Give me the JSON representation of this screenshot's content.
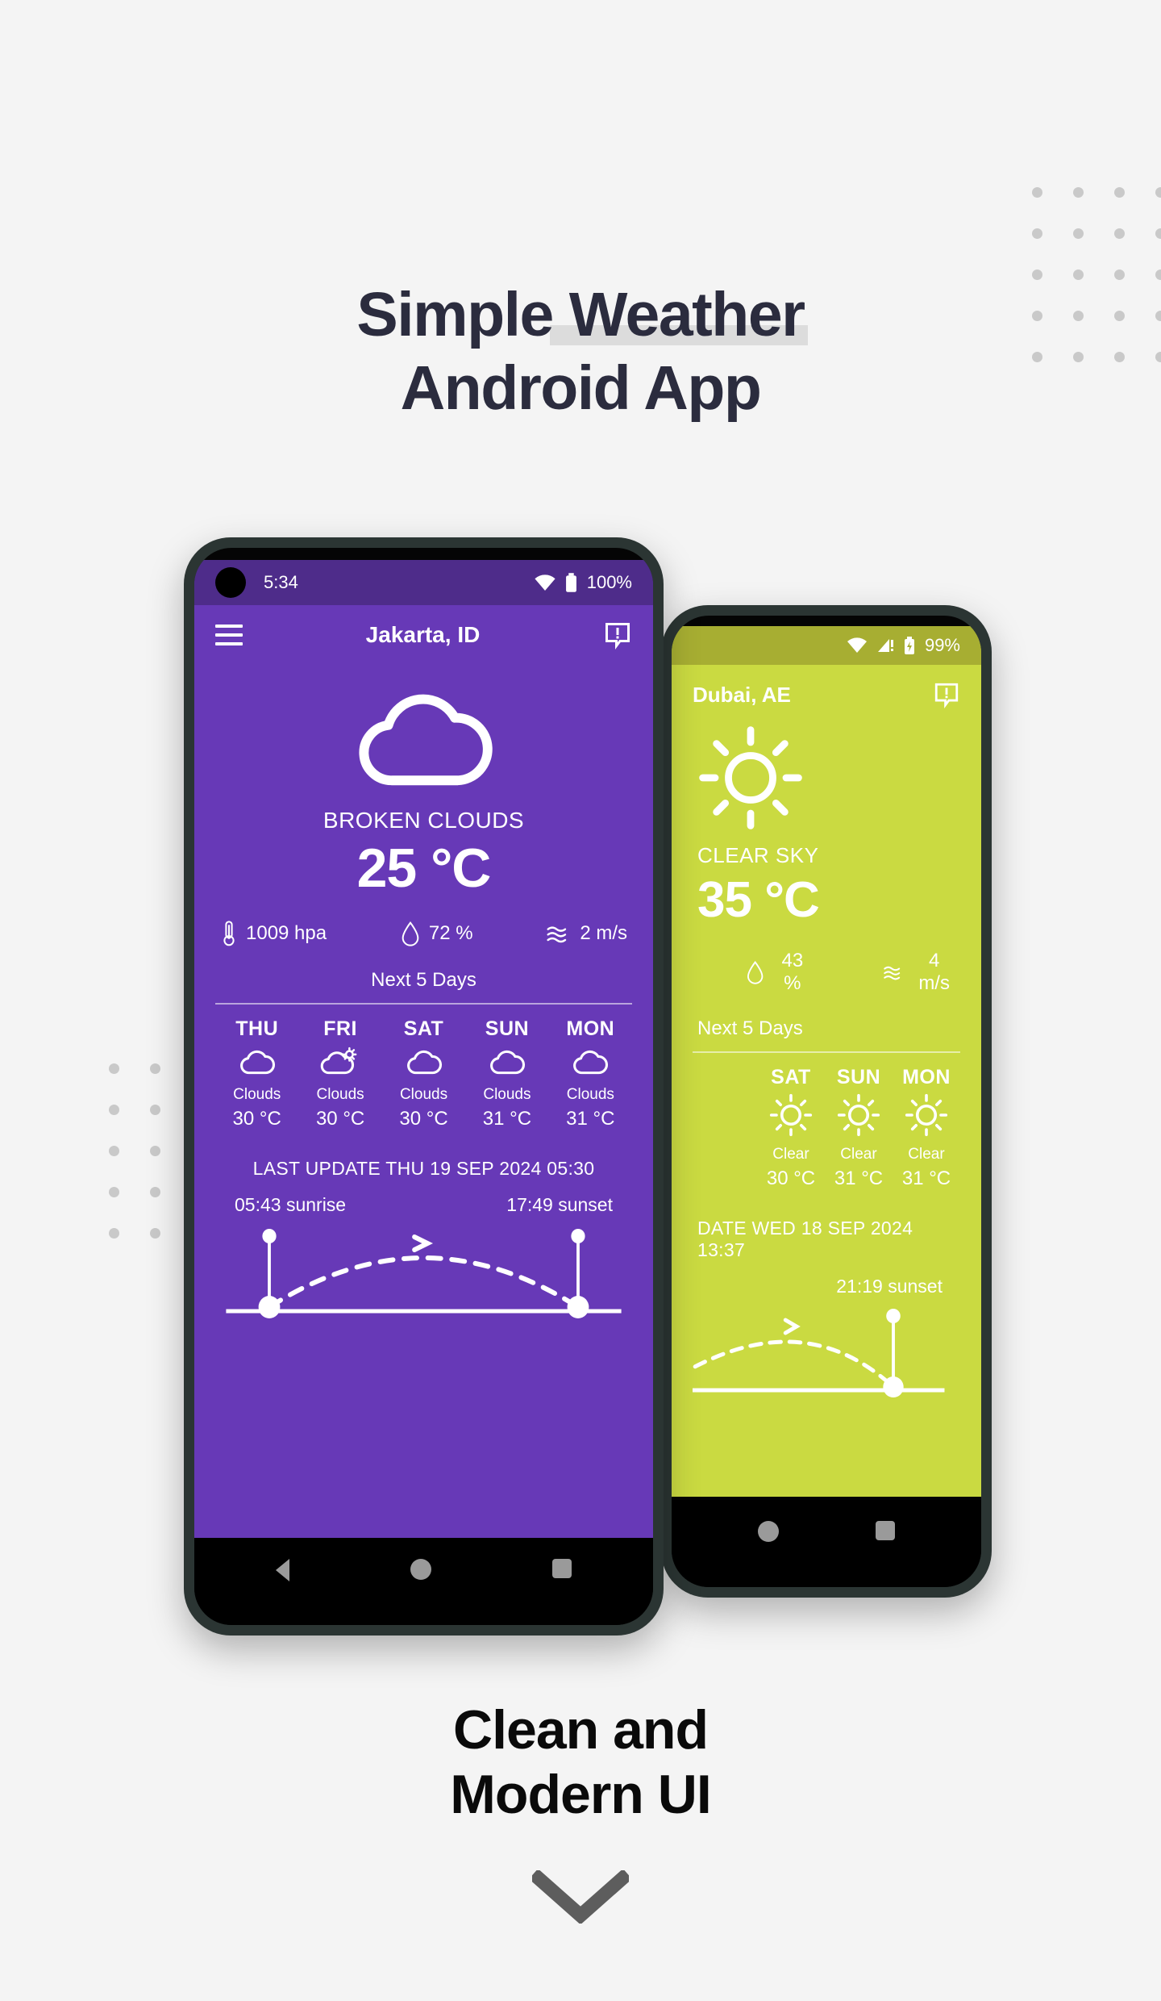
{
  "hero": {
    "line1_a": "Simple",
    "line1_b": "Weather",
    "line2": "Android App"
  },
  "bottom": {
    "line1": "Clean and",
    "line2": "Modern UI",
    "chevron_icon": "chevron-down-icon"
  },
  "colors": {
    "page_bg": "#f4f4f4",
    "heading": "#2b2c3e",
    "highlight": "#dcdcdc",
    "purple": "#6739b7",
    "purple_status": "#4e2c8a",
    "green": "#cada41",
    "green_status": "#a7ae32",
    "dot": "#c9c9c9",
    "bezel": "#2b3533"
  },
  "phone_purple": {
    "statusbar": {
      "time": "5:34",
      "wifi_icon": "wifi-icon",
      "battery_icon": "battery-icon",
      "battery": "100%"
    },
    "appbar": {
      "menu_icon": "hamburger-menu-icon",
      "title": "Jakarta, ID",
      "alert_icon": "feedback-alert-icon"
    },
    "weather_icon": "cloud-icon",
    "condition": "BROKEN CLOUDS",
    "temperature": "25 °C",
    "metrics": [
      {
        "icon": "thermometer-icon",
        "value": "1009 hpa"
      },
      {
        "icon": "humidity-drop-icon",
        "value": "72 %"
      },
      {
        "icon": "wind-waves-icon",
        "value": "2 m/s"
      }
    ],
    "next5_label": "Next 5 Days",
    "forecast": [
      {
        "day": "THU",
        "icon": "cloud-icon",
        "desc": "Clouds",
        "temp": "30 °C"
      },
      {
        "day": "FRI",
        "icon": "cloud-sun-icon",
        "desc": "Clouds",
        "temp": "30 °C"
      },
      {
        "day": "SAT",
        "icon": "cloud-icon",
        "desc": "Clouds",
        "temp": "30 °C"
      },
      {
        "day": "SUN",
        "icon": "cloud-icon",
        "desc": "Clouds",
        "temp": "31 °C"
      },
      {
        "day": "MON",
        "icon": "cloud-icon",
        "desc": "Clouds",
        "temp": "31 °C"
      }
    ],
    "last_update": "LAST UPDATE THU 19 SEP 2024 05:30",
    "sunrise": "05:43 sunrise",
    "sunset": "17:49 sunset",
    "navbar": {
      "back_icon": "nav-back-icon",
      "home_icon": "nav-home-icon",
      "recents_icon": "nav-recents-icon"
    }
  },
  "phone_green": {
    "statusbar": {
      "wifi_icon": "wifi-icon",
      "signal_icon": "signal-alert-icon",
      "battery_icon": "battery-charging-icon",
      "battery": "99%"
    },
    "appbar": {
      "title": "Dubai, AE",
      "alert_icon": "feedback-alert-icon"
    },
    "weather_icon": "sun-icon",
    "condition": "CLEAR SKY",
    "temperature": "35 °C",
    "metrics": [
      {
        "icon": "humidity-drop-icon",
        "value": "43 %"
      },
      {
        "icon": "wind-waves-icon",
        "value": "4 m/s"
      }
    ],
    "next5_label": "Next 5 Days",
    "forecast": [
      {
        "day": "SAT",
        "icon": "sun-icon",
        "desc": "Clear",
        "temp": "30 °C"
      },
      {
        "day": "SUN",
        "icon": "sun-icon",
        "desc": "Clear",
        "temp": "31 °C"
      },
      {
        "day": "MON",
        "icon": "sun-icon",
        "desc": "Clear",
        "temp": "31 °C"
      }
    ],
    "last_update": "DATE WED 18 SEP 2024 13:37",
    "sunset": "21:19 sunset",
    "navbar": {
      "home_icon": "nav-home-icon",
      "recents_icon": "nav-recents-icon"
    }
  }
}
